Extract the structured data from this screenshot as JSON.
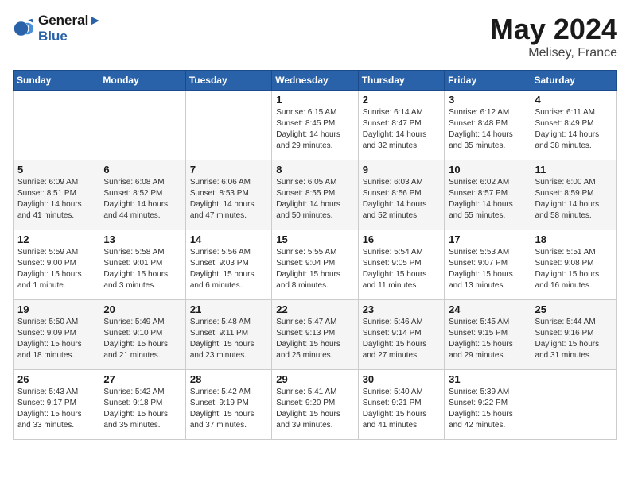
{
  "logo": {
    "line1": "General",
    "line2": "Blue"
  },
  "title": "May 2024",
  "location": "Melisey, France",
  "days_of_week": [
    "Sunday",
    "Monday",
    "Tuesday",
    "Wednesday",
    "Thursday",
    "Friday",
    "Saturday"
  ],
  "weeks": [
    [
      {
        "day": "",
        "sunrise": "",
        "sunset": "",
        "daylight": ""
      },
      {
        "day": "",
        "sunrise": "",
        "sunset": "",
        "daylight": ""
      },
      {
        "day": "",
        "sunrise": "",
        "sunset": "",
        "daylight": ""
      },
      {
        "day": "1",
        "sunrise": "Sunrise: 6:15 AM",
        "sunset": "Sunset: 8:45 PM",
        "daylight": "Daylight: 14 hours and 29 minutes."
      },
      {
        "day": "2",
        "sunrise": "Sunrise: 6:14 AM",
        "sunset": "Sunset: 8:47 PM",
        "daylight": "Daylight: 14 hours and 32 minutes."
      },
      {
        "day": "3",
        "sunrise": "Sunrise: 6:12 AM",
        "sunset": "Sunset: 8:48 PM",
        "daylight": "Daylight: 14 hours and 35 minutes."
      },
      {
        "day": "4",
        "sunrise": "Sunrise: 6:11 AM",
        "sunset": "Sunset: 8:49 PM",
        "daylight": "Daylight: 14 hours and 38 minutes."
      }
    ],
    [
      {
        "day": "5",
        "sunrise": "Sunrise: 6:09 AM",
        "sunset": "Sunset: 8:51 PM",
        "daylight": "Daylight: 14 hours and 41 minutes."
      },
      {
        "day": "6",
        "sunrise": "Sunrise: 6:08 AM",
        "sunset": "Sunset: 8:52 PM",
        "daylight": "Daylight: 14 hours and 44 minutes."
      },
      {
        "day": "7",
        "sunrise": "Sunrise: 6:06 AM",
        "sunset": "Sunset: 8:53 PM",
        "daylight": "Daylight: 14 hours and 47 minutes."
      },
      {
        "day": "8",
        "sunrise": "Sunrise: 6:05 AM",
        "sunset": "Sunset: 8:55 PM",
        "daylight": "Daylight: 14 hours and 50 minutes."
      },
      {
        "day": "9",
        "sunrise": "Sunrise: 6:03 AM",
        "sunset": "Sunset: 8:56 PM",
        "daylight": "Daylight: 14 hours and 52 minutes."
      },
      {
        "day": "10",
        "sunrise": "Sunrise: 6:02 AM",
        "sunset": "Sunset: 8:57 PM",
        "daylight": "Daylight: 14 hours and 55 minutes."
      },
      {
        "day": "11",
        "sunrise": "Sunrise: 6:00 AM",
        "sunset": "Sunset: 8:59 PM",
        "daylight": "Daylight: 14 hours and 58 minutes."
      }
    ],
    [
      {
        "day": "12",
        "sunrise": "Sunrise: 5:59 AM",
        "sunset": "Sunset: 9:00 PM",
        "daylight": "Daylight: 15 hours and 1 minute."
      },
      {
        "day": "13",
        "sunrise": "Sunrise: 5:58 AM",
        "sunset": "Sunset: 9:01 PM",
        "daylight": "Daylight: 15 hours and 3 minutes."
      },
      {
        "day": "14",
        "sunrise": "Sunrise: 5:56 AM",
        "sunset": "Sunset: 9:03 PM",
        "daylight": "Daylight: 15 hours and 6 minutes."
      },
      {
        "day": "15",
        "sunrise": "Sunrise: 5:55 AM",
        "sunset": "Sunset: 9:04 PM",
        "daylight": "Daylight: 15 hours and 8 minutes."
      },
      {
        "day": "16",
        "sunrise": "Sunrise: 5:54 AM",
        "sunset": "Sunset: 9:05 PM",
        "daylight": "Daylight: 15 hours and 11 minutes."
      },
      {
        "day": "17",
        "sunrise": "Sunrise: 5:53 AM",
        "sunset": "Sunset: 9:07 PM",
        "daylight": "Daylight: 15 hours and 13 minutes."
      },
      {
        "day": "18",
        "sunrise": "Sunrise: 5:51 AM",
        "sunset": "Sunset: 9:08 PM",
        "daylight": "Daylight: 15 hours and 16 minutes."
      }
    ],
    [
      {
        "day": "19",
        "sunrise": "Sunrise: 5:50 AM",
        "sunset": "Sunset: 9:09 PM",
        "daylight": "Daylight: 15 hours and 18 minutes."
      },
      {
        "day": "20",
        "sunrise": "Sunrise: 5:49 AM",
        "sunset": "Sunset: 9:10 PM",
        "daylight": "Daylight: 15 hours and 21 minutes."
      },
      {
        "day": "21",
        "sunrise": "Sunrise: 5:48 AM",
        "sunset": "Sunset: 9:11 PM",
        "daylight": "Daylight: 15 hours and 23 minutes."
      },
      {
        "day": "22",
        "sunrise": "Sunrise: 5:47 AM",
        "sunset": "Sunset: 9:13 PM",
        "daylight": "Daylight: 15 hours and 25 minutes."
      },
      {
        "day": "23",
        "sunrise": "Sunrise: 5:46 AM",
        "sunset": "Sunset: 9:14 PM",
        "daylight": "Daylight: 15 hours and 27 minutes."
      },
      {
        "day": "24",
        "sunrise": "Sunrise: 5:45 AM",
        "sunset": "Sunset: 9:15 PM",
        "daylight": "Daylight: 15 hours and 29 minutes."
      },
      {
        "day": "25",
        "sunrise": "Sunrise: 5:44 AM",
        "sunset": "Sunset: 9:16 PM",
        "daylight": "Daylight: 15 hours and 31 minutes."
      }
    ],
    [
      {
        "day": "26",
        "sunrise": "Sunrise: 5:43 AM",
        "sunset": "Sunset: 9:17 PM",
        "daylight": "Daylight: 15 hours and 33 minutes."
      },
      {
        "day": "27",
        "sunrise": "Sunrise: 5:42 AM",
        "sunset": "Sunset: 9:18 PM",
        "daylight": "Daylight: 15 hours and 35 minutes."
      },
      {
        "day": "28",
        "sunrise": "Sunrise: 5:42 AM",
        "sunset": "Sunset: 9:19 PM",
        "daylight": "Daylight: 15 hours and 37 minutes."
      },
      {
        "day": "29",
        "sunrise": "Sunrise: 5:41 AM",
        "sunset": "Sunset: 9:20 PM",
        "daylight": "Daylight: 15 hours and 39 minutes."
      },
      {
        "day": "30",
        "sunrise": "Sunrise: 5:40 AM",
        "sunset": "Sunset: 9:21 PM",
        "daylight": "Daylight: 15 hours and 41 minutes."
      },
      {
        "day": "31",
        "sunrise": "Sunrise: 5:39 AM",
        "sunset": "Sunset: 9:22 PM",
        "daylight": "Daylight: 15 hours and 42 minutes."
      },
      {
        "day": "",
        "sunrise": "",
        "sunset": "",
        "daylight": ""
      }
    ]
  ]
}
